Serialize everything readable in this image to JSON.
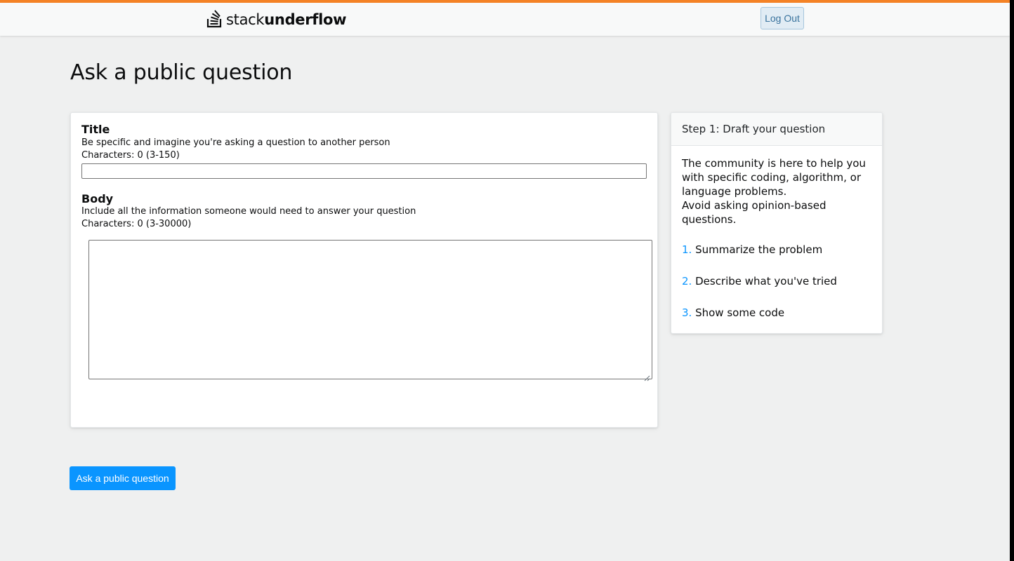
{
  "header": {
    "logo_icon": "stack-logo-icon",
    "logo_text_light": "stack",
    "logo_text_bold": "underflow",
    "logout_label": "Log Out"
  },
  "page": {
    "title": "Ask a public question"
  },
  "form": {
    "title_label": "Title",
    "title_desc": "Be specific and imagine you're asking a question to another person",
    "title_counter": "Characters: 0 (3-150)",
    "title_value": "",
    "body_label": "Body",
    "body_desc": "Include all the information someone would need to answer your question",
    "body_counter": "Characters: 0 (3-30000)",
    "body_value": ""
  },
  "help": {
    "header": "Step 1: Draft your question",
    "intro_line1": "The community is here to help you with specific coding, algorithm, or language problems.",
    "intro_line2": "Avoid asking opinion-based questions.",
    "steps": [
      {
        "num": "1.",
        "text": "Summarize the problem"
      },
      {
        "num": "2.",
        "text": "Describe what you've tried"
      },
      {
        "num": "3.",
        "text": "Show some code"
      }
    ]
  },
  "submit_label": "Ask a public question",
  "colors": {
    "accent_orange": "#f48225",
    "primary_blue": "#0a95ff",
    "logout_bg": "#e1ecf4",
    "logout_text": "#39739d"
  }
}
